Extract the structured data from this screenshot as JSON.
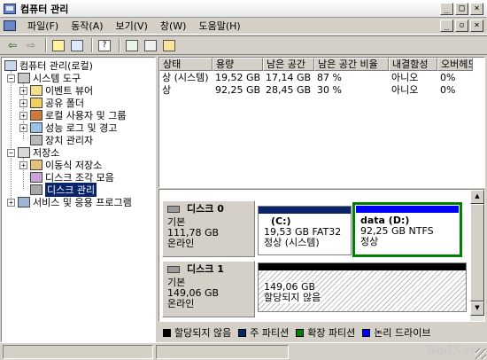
{
  "window": {
    "title": "컴퓨터 관리"
  },
  "menu": [
    "파일(F)",
    "동작(A)",
    "보기(V)",
    "창(W)",
    "도움말(H)"
  ],
  "tree": {
    "root": "컴퓨터 관리(로컬)",
    "system_tools": "시스템 도구",
    "event_viewer": "이벤트 뷰어",
    "shared_folders": "공유 폴더",
    "local_users": "로컬 사용자 및 그룹",
    "perf_logs": "성능 로그 및 경고",
    "device_manager": "장치 관리자",
    "storage": "저장소",
    "removable_storage": "이동식 저장소",
    "defrag": "디스크 조각 모음",
    "disk_management": "디스크 관리",
    "services_apps": "서비스 및 응용 프로그램"
  },
  "volumes": {
    "headers": [
      "상태",
      "용량",
      "남은 공간",
      "남은 공간 비율",
      "내결함성",
      "오버헤드"
    ],
    "rows": [
      [
        "상 (시스템)",
        "19,52 GB",
        "17,14 GB",
        "87 %",
        "아니오",
        "0%"
      ],
      [
        "상",
        "92,25 GB",
        "28,45 GB",
        "30 %",
        "아니오",
        "0%"
      ]
    ]
  },
  "disks": [
    {
      "name": "디스크 0",
      "type": "기본",
      "size": "111,78 GB",
      "status": "온라인",
      "partitions": [
        {
          "label": "(C:)",
          "detail": "19,53 GB FAT32",
          "state": "정상 (시스템)"
        },
        {
          "label": "data  (D:)",
          "detail": "92,25 GB NTFS",
          "state": "정상"
        }
      ]
    },
    {
      "name": "디스크 1",
      "type": "기본",
      "size": "149,06 GB",
      "status": "온라인",
      "partitions": [
        {
          "label": "",
          "detail": "149,06 GB",
          "state": "할당되지 않음"
        }
      ]
    }
  ],
  "legend": [
    {
      "label": "할당되지 않음",
      "color": "#000000"
    },
    {
      "label": "주 파티션",
      "color": "#0a246a"
    },
    {
      "label": "확장 파티션",
      "color": "#008000"
    },
    {
      "label": "논리 드라이브",
      "color": "#0000ff"
    }
  ],
  "watermark": "BodNara"
}
